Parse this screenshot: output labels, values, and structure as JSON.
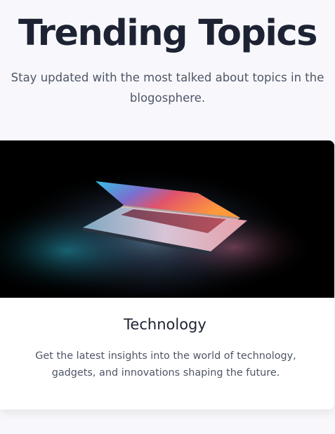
{
  "hero": {
    "title": "Trending Topics",
    "subtitle": "Stay updated with the most talked about topics in the blogosphere."
  },
  "topics": [
    {
      "title": "Technology",
      "description": "Get the latest insights into the world of technology, gadgets, and innovations shaping the future.",
      "image": "laptop-photo"
    }
  ],
  "colors": {
    "background": "#f8f8fc",
    "heading": "#1d2333",
    "body_text": "#4d5566",
    "card": "#ffffff"
  }
}
